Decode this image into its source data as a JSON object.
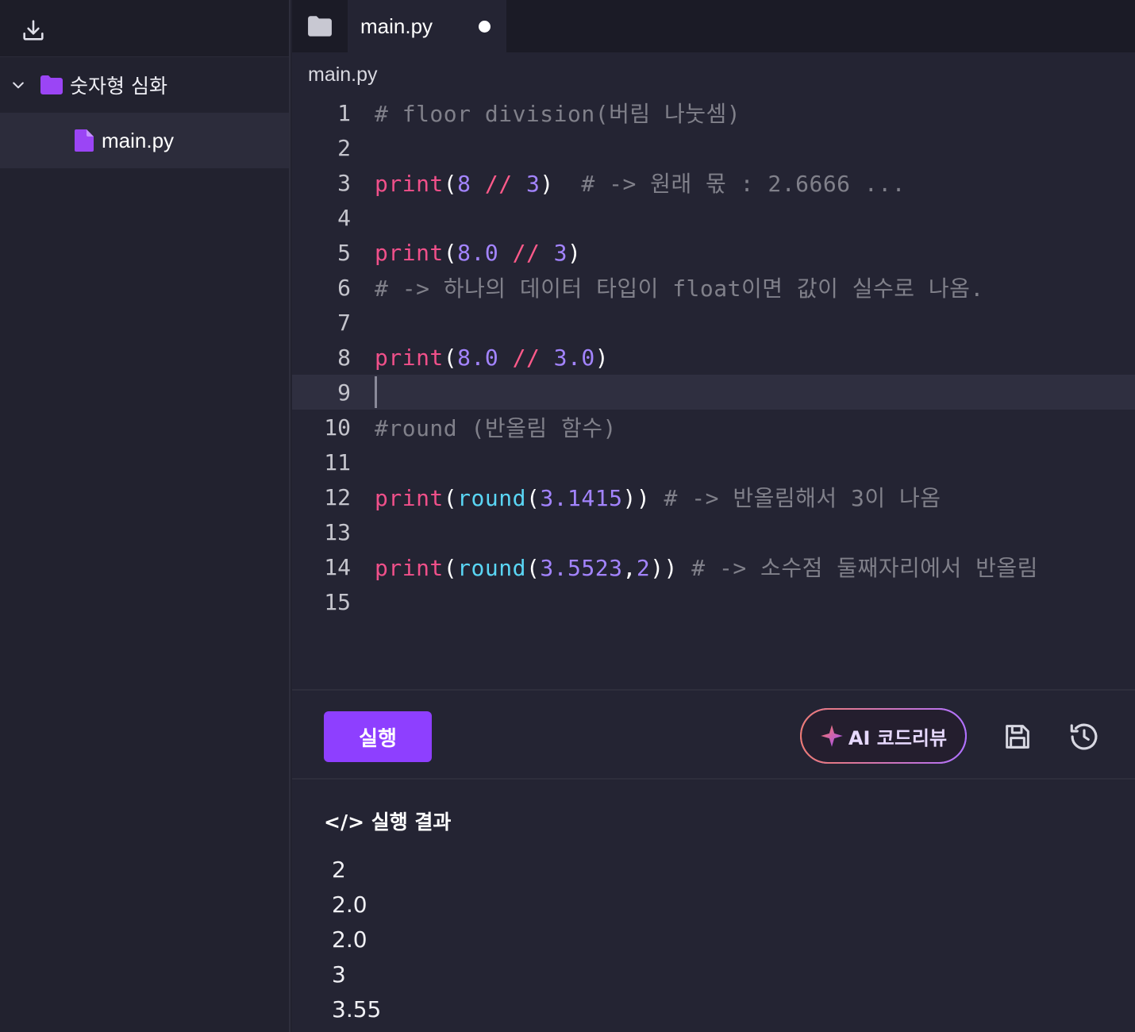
{
  "sidebar": {
    "folder_label": "숫자형 심화",
    "file_label": "main.py"
  },
  "tabs": [
    {
      "label": "main.py",
      "modified": true
    }
  ],
  "editor": {
    "path": "main.py",
    "active_line": 9,
    "lines": [
      {
        "n": "1",
        "text": "# floor division(버림 나눗셈)"
      },
      {
        "n": "2",
        "text": ""
      },
      {
        "n": "3",
        "text": "print(8 // 3)  # -> 원래 몫 : 2.6666 ..."
      },
      {
        "n": "4",
        "text": ""
      },
      {
        "n": "5",
        "text": "print(8.0 // 3)"
      },
      {
        "n": "6",
        "text": "# -> 하나의 데이터 타입이 float이면 값이 실수로 나옴."
      },
      {
        "n": "7",
        "text": ""
      },
      {
        "n": "8",
        "text": "print(8.0 // 3.0)"
      },
      {
        "n": "9",
        "text": ""
      },
      {
        "n": "10",
        "text": "#round (반올림 함수)"
      },
      {
        "n": "11",
        "text": ""
      },
      {
        "n": "12",
        "text": "print(round(3.1415)) # -> 반올림해서 3이 나옴"
      },
      {
        "n": "13",
        "text": ""
      },
      {
        "n": "14",
        "text": "print(round(3.5523,2)) # -> 소수점 둘째자리에서 반올림"
      },
      {
        "n": "15",
        "text": ""
      }
    ]
  },
  "toolbar": {
    "run_label": "실행",
    "ai_review_label": "AI 코드리뷰"
  },
  "output": {
    "title": "</> 실행 결과",
    "lines": [
      "2",
      "2.0",
      "2.0",
      "3",
      "3.55"
    ]
  },
  "colors": {
    "accent": "#8e3fff",
    "keyword": "#f0508a",
    "number": "#a384ff",
    "function": "#5ad6f5",
    "comment": "#80808a"
  }
}
